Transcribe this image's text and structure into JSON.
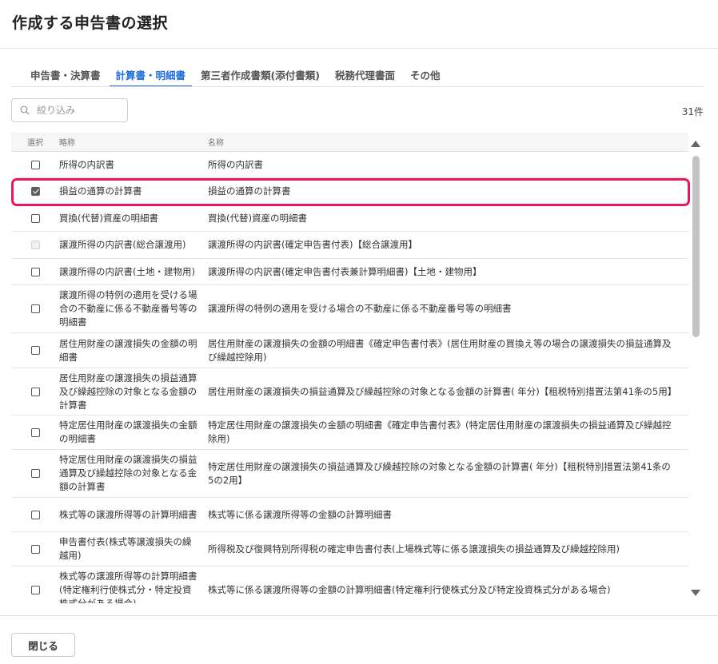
{
  "dialog": {
    "title": "作成する申告書の選択"
  },
  "tabs": [
    {
      "label": "申告書・決算書",
      "active": false
    },
    {
      "label": "計算書・明細書",
      "active": true
    },
    {
      "label": "第三者作成書類(添付書類)",
      "active": false
    },
    {
      "label": "税務代理書面",
      "active": false
    },
    {
      "label": "その他",
      "active": false
    }
  ],
  "search": {
    "placeholder": "絞り込み",
    "value": ""
  },
  "result_count": "31件",
  "table": {
    "columns": [
      "選択",
      "略称",
      "名称"
    ],
    "rows": [
      {
        "short": "所得の内訳書",
        "name": "所得の内訳書",
        "state": "unchecked"
      },
      {
        "short": "損益の通算の計算書",
        "name": "損益の通算の計算書",
        "state": "checked"
      },
      {
        "short": "買換(代替)資産の明細書",
        "name": "買換(代替)資産の明細書",
        "state": "unchecked"
      },
      {
        "short": "譲渡所得の内訳書(総合譲渡用)",
        "name": "譲渡所得の内訳書(確定申告書付表)【総合譲渡用】",
        "state": "disabled"
      },
      {
        "short": "譲渡所得の内訳書(土地・建物用)",
        "name": "譲渡所得の内訳書(確定申告書付表兼計算明細書)【土地・建物用】",
        "state": "unchecked"
      },
      {
        "short": "譲渡所得の特例の適用を受ける場合の不動産に係る不動産番号等の明細書",
        "name": "譲渡所得の特例の適用を受ける場合の不動産に係る不動産番号等の明細書",
        "state": "unchecked"
      },
      {
        "short": "居住用財産の譲渡損失の金額の明細書",
        "name": "居住用財産の譲渡損失の金額の明細書《確定申告書付表》(居住用財産の買換え等の場合の譲渡損失の損益通算及び繰越控除用)",
        "state": "unchecked"
      },
      {
        "short": "居住用財産の譲渡損失の損益通算及び繰越控除の対象となる金額の計算書",
        "name": "居住用財産の譲渡損失の損益通算及び繰越控除の対象となる金額の計算書( 年分)【租税特別措置法第41条の5用】",
        "state": "unchecked"
      },
      {
        "short": "特定居住用財産の譲渡損失の金額の明細書",
        "name": "特定居住用財産の譲渡損失の金額の明細書《確定申告書付表》(特定居住用財産の譲渡損失の損益通算及び繰越控除用)",
        "state": "unchecked"
      },
      {
        "short": "特定居住用財産の譲渡損失の損益通算及び繰越控除の対象となる金額の計算書",
        "name": "特定居住用財産の譲渡損失の損益通算及び繰越控除の対象となる金額の計算書( 年分)【租税特別措置法第41条の5の2用】",
        "state": "unchecked"
      },
      {
        "short": "株式等の譲渡所得等の計算明細書",
        "name": "株式等に係る譲渡所得等の金額の計算明細書",
        "state": "unchecked"
      },
      {
        "short": "申告書付表(株式等譲渡損失の繰越用)",
        "name": "所得税及び復興特別所得税の確定申告書付表(上場株式等に係る譲渡損失の損益通算及び繰越控除用)",
        "state": "unchecked"
      },
      {
        "short": "株式等の譲渡所得等の計算明細書(特定権利行使株式分・特定投資株式分がある場合)",
        "name": "株式等に係る譲渡所得等の金額の計算明細書(特定権利行使株式分及び特定投資株式分がある場合)",
        "state": "unchecked"
      }
    ]
  },
  "footer": {
    "close_label": "閉じる"
  },
  "colors": {
    "accent": "#1e6fd9",
    "highlight": "#e8175d"
  }
}
